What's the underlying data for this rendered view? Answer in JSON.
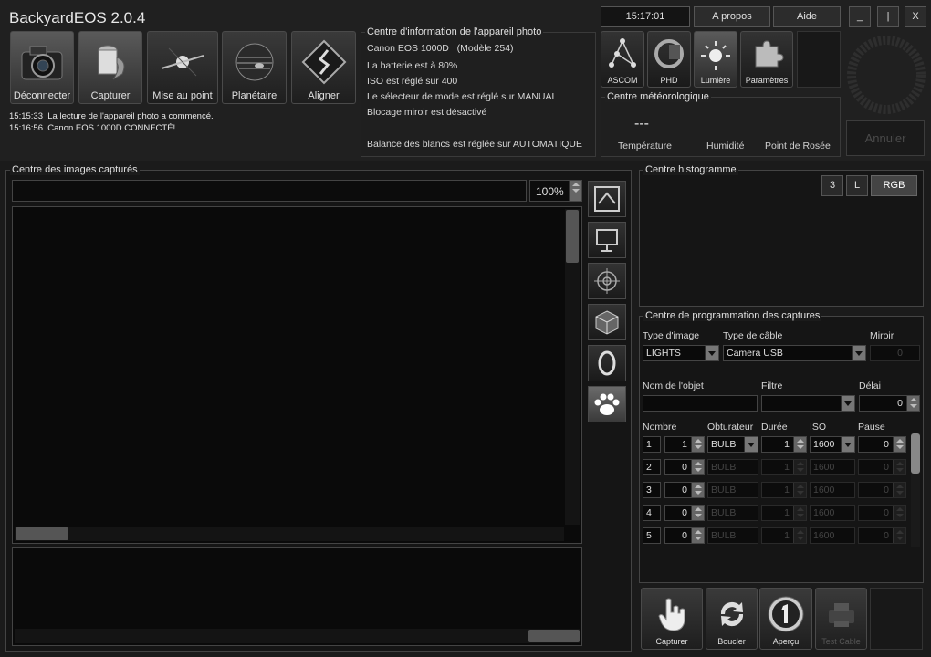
{
  "app": {
    "title": "BackyardEOS 2.0.4"
  },
  "header": {
    "clock": "15:17:01",
    "about_label": "A propos",
    "help_label": "Aide",
    "minimize_label": "_",
    "restore_label": "|",
    "close_label": "X"
  },
  "toolbar": {
    "buttons": [
      {
        "label": "Déconnecter",
        "icon": "camera-icon"
      },
      {
        "label": "Capturer",
        "icon": "film-roll-icon"
      },
      {
        "label": "Mise au point",
        "icon": "focus-star-icon"
      },
      {
        "label": "Planétaire",
        "icon": "planet-icon"
      },
      {
        "label": "Aligner",
        "icon": "align-icon"
      }
    ]
  },
  "log": [
    {
      "time": "15:15:33",
      "message": "La lecture de l'appareil photo a commencé."
    },
    {
      "time": "15:16:56",
      "message": "Canon EOS 1000D CONNECTÉ!"
    }
  ],
  "camera_info": {
    "title": "Centre d'information de l'appareil photo",
    "model": "Canon EOS 1000D",
    "model_number": "(Modèle 254)",
    "lines": [
      "La batterie est à 80%",
      "ISO est réglé sur 400",
      "Le sélecteur de mode est réglé sur MANUAL",
      "Blocage miroir est désactivé",
      "Balance des blancs est réglée sur AUTOMATIQUE"
    ]
  },
  "plugins": [
    {
      "label": "ASCOM",
      "icon": "ascom-constellation-icon"
    },
    {
      "label": "PHD",
      "icon": "phd-guide-icon"
    },
    {
      "label": "Lumière",
      "icon": "light-sun-icon"
    },
    {
      "label": "Paramètres",
      "icon": "puzzle-icon"
    }
  ],
  "weather": {
    "title": "Centre météorologique",
    "temperature_value": "---",
    "temperature_label": "Température",
    "humidity_label": "Humidité",
    "dewpoint_label": "Point de Rosée"
  },
  "cancel_label": "Annuler",
  "images": {
    "title": "Centre des images capturés",
    "zoom": "100%"
  },
  "side_tools": [
    "frame-up-icon",
    "presentation-icon",
    "crosshair-icon",
    "cube-icon",
    "ring-icon",
    "paw-icon"
  ],
  "histogram": {
    "title": "Centre histogramme",
    "buttons": [
      "3",
      "L",
      "RGB"
    ]
  },
  "capture_plan": {
    "title": "Centre de programmation des captures",
    "image_type_label": "Type d'image",
    "image_type_value": "LIGHTS",
    "cable_type_label": "Type de câble",
    "cable_type_value": "Camera USB",
    "mirror_label": "Miroir",
    "mirror_value": "0",
    "object_label": "Nom de l'objet",
    "object_value": "",
    "filter_label": "Filtre",
    "filter_value": "",
    "delay_label": "Délai",
    "delay_value": "0",
    "columns": [
      "Nombre",
      "Obturateur",
      "Durée",
      "ISO",
      "Pause"
    ],
    "rows": [
      {
        "index": "1",
        "count": "1",
        "shutter": "BULB",
        "duration": "1",
        "iso": "1600",
        "pause": "0",
        "active": true
      },
      {
        "index": "2",
        "count": "0",
        "shutter": "BULB",
        "duration": "1",
        "iso": "1600",
        "pause": "0",
        "active": false
      },
      {
        "index": "3",
        "count": "0",
        "shutter": "BULB",
        "duration": "1",
        "iso": "1600",
        "pause": "0",
        "active": false
      },
      {
        "index": "4",
        "count": "0",
        "shutter": "BULB",
        "duration": "1",
        "iso": "1600",
        "pause": "0",
        "active": false
      },
      {
        "index": "5",
        "count": "0",
        "shutter": "BULB",
        "duration": "1",
        "iso": "1600",
        "pause": "0",
        "active": false
      }
    ]
  },
  "actions": [
    {
      "label": "Capturer",
      "icon": "hand-pointer-icon"
    },
    {
      "label": "Boucler",
      "icon": "loop-arrows-icon"
    },
    {
      "label": "Aperçu",
      "icon": "preview-one-icon"
    },
    {
      "label": "Test Cable",
      "icon": "printer-icon"
    }
  ]
}
